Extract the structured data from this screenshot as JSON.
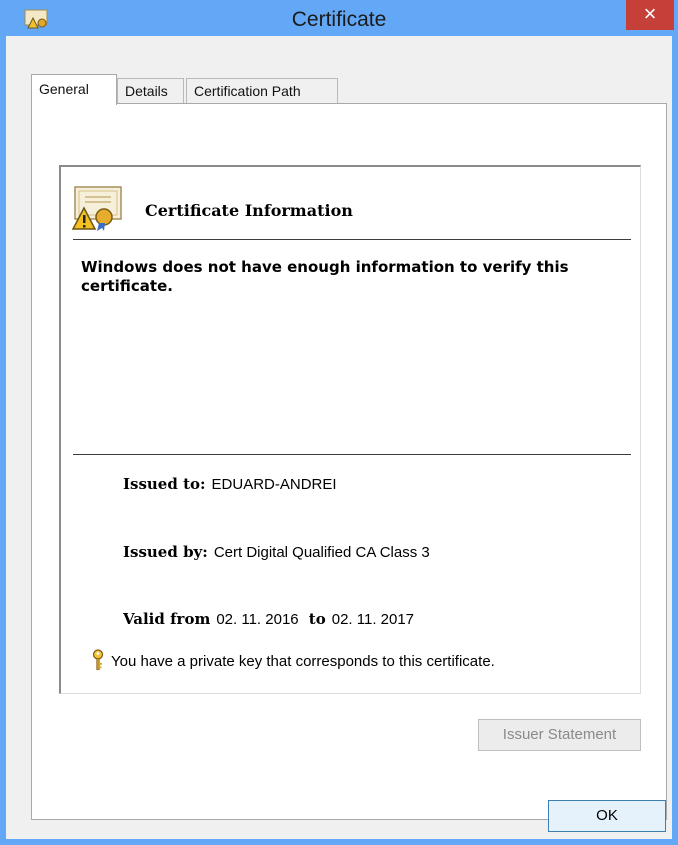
{
  "window": {
    "title": "Certificate",
    "title_icon": "certificate-icon",
    "close_glyph": "×"
  },
  "tabs": [
    {
      "label": "General",
      "active": true
    },
    {
      "label": "Details",
      "active": false
    },
    {
      "label": "Certification Path",
      "active": false
    }
  ],
  "general": {
    "heading": "Certificate Information",
    "warning": "Windows does not have enough information to verify this certificate.",
    "issued_to_label": "Issued to:",
    "issued_to_value": "EDUARD-ANDREI",
    "issued_by_label": "Issued by:",
    "issued_by_value": "Cert Digital Qualified CA Class 3",
    "valid_from_label": "Valid from",
    "valid_from_value": "02. 11. 2016",
    "valid_to_label": "to",
    "valid_to_value": "02. 11. 2017",
    "private_key_text": "You have a private key that corresponds to this certificate."
  },
  "buttons": {
    "issuer_statement": "Issuer Statement",
    "ok": "OK"
  },
  "colors": {
    "titlebar": "#62a8f7",
    "close_button": "#c6403a",
    "dialog_background": "#f0f0f0"
  }
}
